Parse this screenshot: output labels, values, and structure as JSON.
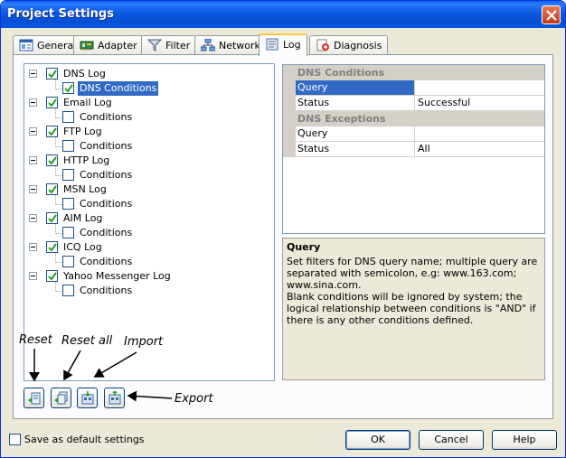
{
  "window": {
    "title": "Project Settings"
  },
  "tabs": [
    {
      "id": "general",
      "label": "General",
      "icon": "general-icon"
    },
    {
      "id": "adapter",
      "label": "Adapter",
      "icon": "adapter-icon"
    },
    {
      "id": "filter",
      "label": "Filter",
      "icon": "filter-icon"
    },
    {
      "id": "network",
      "label": "Network",
      "icon": "network-icon"
    },
    {
      "id": "log",
      "label": "Log",
      "icon": "log-icon",
      "active": true
    },
    {
      "id": "diagnosis",
      "label": "Diagnosis",
      "icon": "diagnosis-icon"
    }
  ],
  "tree": [
    {
      "label": "DNS Log",
      "checked": true,
      "child": {
        "label": "DNS Conditions",
        "checked": true,
        "selected": true
      }
    },
    {
      "label": "Email Log",
      "checked": true,
      "child": {
        "label": "Conditions",
        "checked": false
      }
    },
    {
      "label": "FTP Log",
      "checked": true,
      "child": {
        "label": "Conditions",
        "checked": false
      }
    },
    {
      "label": "HTTP Log",
      "checked": true,
      "child": {
        "label": "Conditions",
        "checked": false
      }
    },
    {
      "label": "MSN Log",
      "checked": true,
      "child": {
        "label": "Conditions",
        "checked": false
      }
    },
    {
      "label": "AIM Log",
      "checked": true,
      "child": {
        "label": "Conditions",
        "checked": false
      }
    },
    {
      "label": "ICQ Log",
      "checked": true,
      "child": {
        "label": "Conditions",
        "checked": false
      }
    },
    {
      "label": "Yahoo Messenger Log",
      "checked": true,
      "child": {
        "label": "Conditions",
        "checked": false
      }
    }
  ],
  "annotations": {
    "reset": "Reset",
    "reset_all": "Reset all",
    "import": "Import",
    "export": "Export"
  },
  "property_grid": {
    "categories": [
      {
        "title": "DNS Conditions",
        "rows": [
          {
            "name": "Query",
            "value": "",
            "selected": true
          },
          {
            "name": "Status",
            "value": "Successful"
          }
        ]
      },
      {
        "title": "DNS Exceptions",
        "rows": [
          {
            "name": "Query",
            "value": ""
          },
          {
            "name": "Status",
            "value": "All"
          }
        ]
      }
    ]
  },
  "description": {
    "title": "Query",
    "line1": "Set filters for DNS query name; multiple query are separated with semicolon, e.g: www.163.com; www.sina.com.",
    "line2": "Blank conditions will be ignored by system; the logical relationship between conditions is \"AND\" if there is any other conditions defined."
  },
  "footer": {
    "default_label": "Save as default settings",
    "ok": "OK",
    "cancel": "Cancel",
    "help": "Help"
  },
  "colors": {
    "selection": "#316ac5",
    "titlebar": "#0b58e2",
    "check": "#21a121"
  }
}
